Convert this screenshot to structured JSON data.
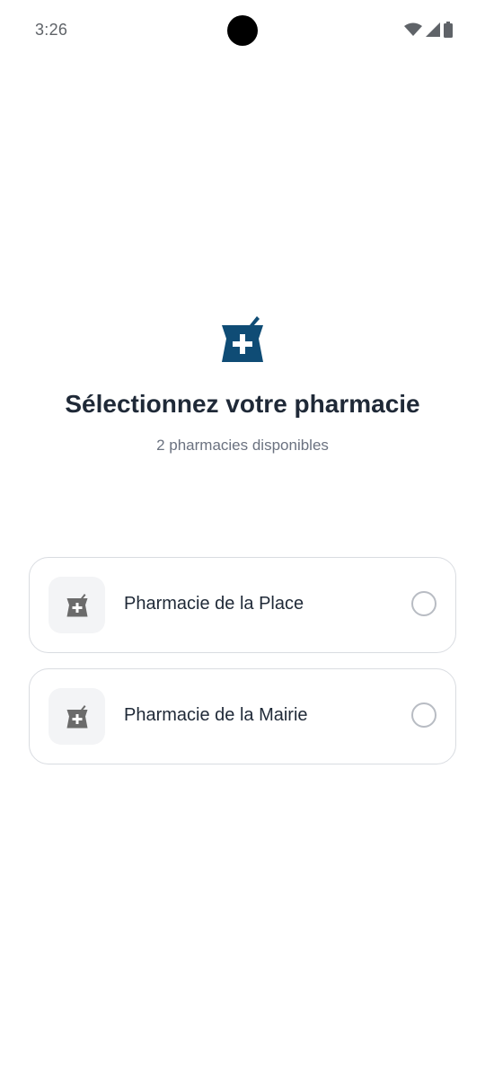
{
  "status_bar": {
    "time": "3:26",
    "icons": [
      "wifi-icon",
      "signal-icon",
      "battery-icon"
    ]
  },
  "header": {
    "icon": "pharmacy-icon",
    "title": "Sélectionnez votre pharmacie",
    "subtitle": "2 pharmacies disponibles"
  },
  "pharmacies": [
    {
      "name": "Pharmacie de la Place",
      "icon": "pharmacy-icon",
      "selected": false
    },
    {
      "name": "Pharmacie de la Mairie",
      "icon": "pharmacy-icon",
      "selected": false
    }
  ],
  "colors": {
    "accent": "#0f4c75",
    "card_icon": "#6b6b6b",
    "title": "#1f2937",
    "subtitle": "#6b7280"
  }
}
